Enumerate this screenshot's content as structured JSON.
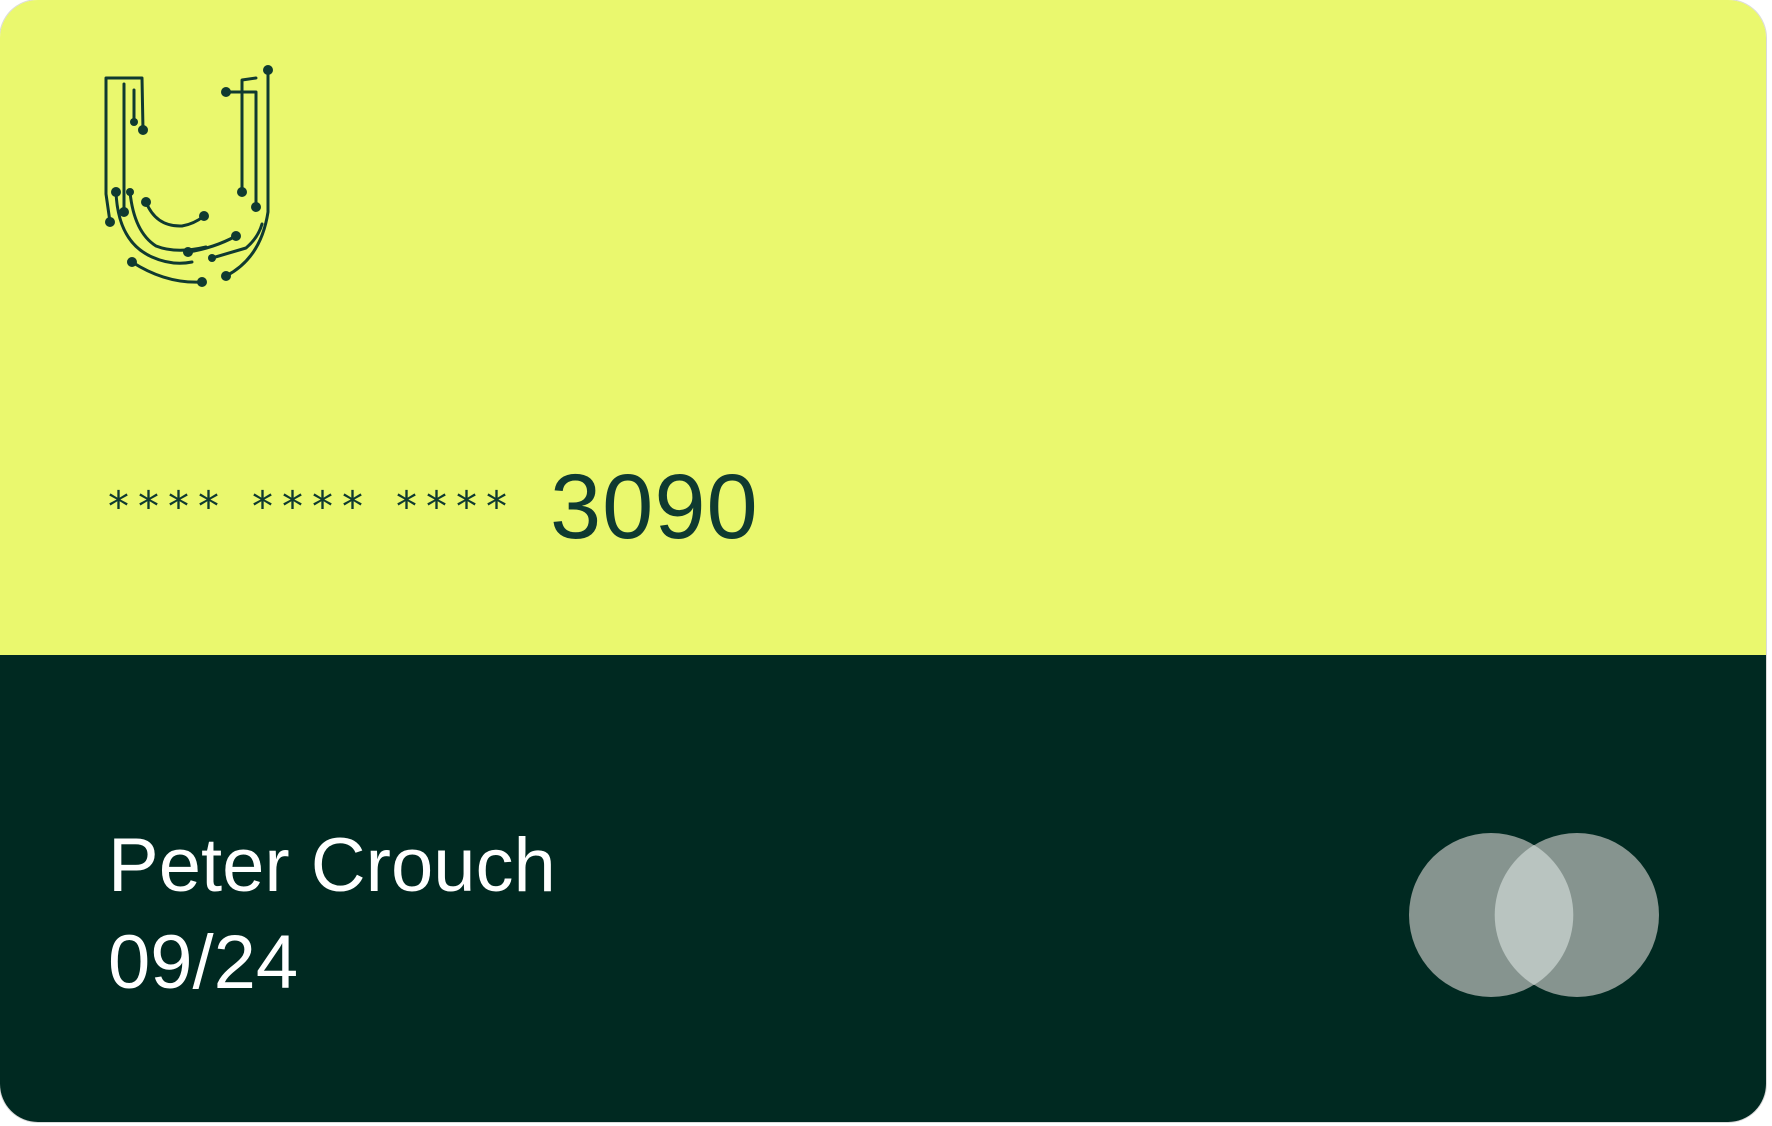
{
  "card": {
    "masked_groups": [
      "****",
      "****",
      "****"
    ],
    "last4": "3090",
    "holder_name": "Peter Crouch",
    "expiry": "09/24"
  },
  "icons": {
    "brand_logo": "circuit-u-logo-icon",
    "network_logo": "overlapping-circles-network-icon"
  },
  "colors": {
    "top": "#eaf86e",
    "bottom": "#002921",
    "ink": "#0f3a30",
    "text_on_dark": "#ffffff"
  }
}
